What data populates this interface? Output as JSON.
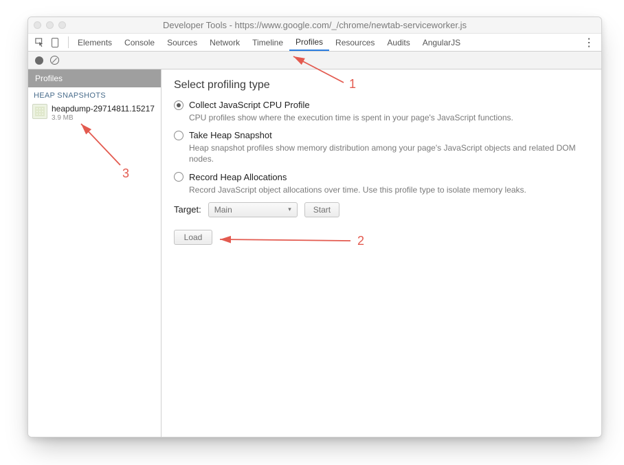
{
  "window_title": "Developer Tools - https://www.google.com/_/chrome/newtab-serviceworker.js",
  "tabs": {
    "items": [
      "Elements",
      "Console",
      "Sources",
      "Network",
      "Timeline",
      "Profiles",
      "Resources",
      "Audits",
      "AngularJS"
    ],
    "active_index": 5
  },
  "sidebar": {
    "title": "Profiles",
    "section": "HEAP SNAPSHOTS",
    "snapshot": {
      "name": "heapdump-29714811.15217",
      "size": "3.9 MB"
    }
  },
  "profiles": {
    "heading": "Select profiling type",
    "options": [
      {
        "label": "Collect JavaScript CPU Profile",
        "desc": "CPU profiles show where the execution time is spent in your page's JavaScript functions.",
        "selected": true
      },
      {
        "label": "Take Heap Snapshot",
        "desc": "Heap snapshot profiles show memory distribution among your page's JavaScript objects and related DOM nodes.",
        "selected": false
      },
      {
        "label": "Record Heap Allocations",
        "desc": "Record JavaScript object allocations over time. Use this profile type to isolate memory leaks.",
        "selected": false
      }
    ],
    "target_label": "Target:",
    "target_value": "Main",
    "start_label": "Start",
    "load_label": "Load"
  },
  "annotations": {
    "a1": "1",
    "a2": "2",
    "a3": "3"
  }
}
